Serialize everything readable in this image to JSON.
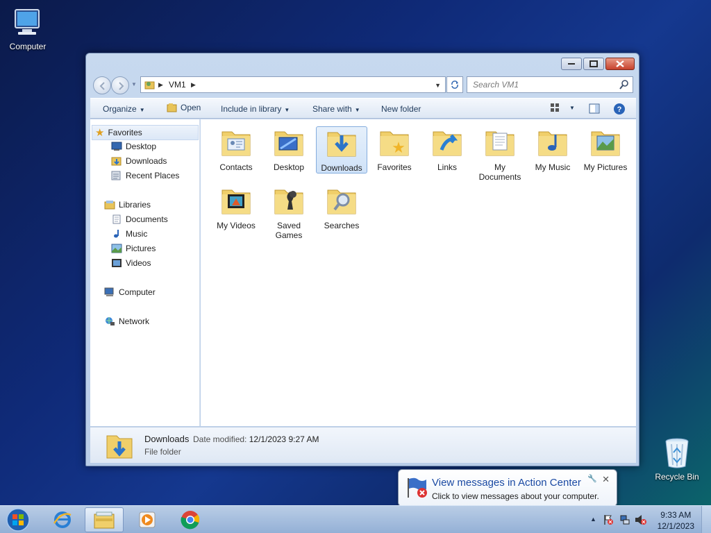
{
  "desktop": {
    "computer_label": "Computer",
    "recycle_label": "Recycle Bin"
  },
  "window": {
    "breadcrumb": "VM1",
    "search_placeholder": "Search VM1"
  },
  "toolbar": {
    "organize": "Organize",
    "open": "Open",
    "include": "Include in library",
    "share": "Share with",
    "new_folder": "New folder"
  },
  "nav": {
    "favorites": "Favorites",
    "desktop": "Desktop",
    "downloads": "Downloads",
    "recent": "Recent Places",
    "libraries": "Libraries",
    "documents": "Documents",
    "music": "Music",
    "pictures": "Pictures",
    "videos": "Videos",
    "computer": "Computer",
    "network": "Network"
  },
  "folders": [
    {
      "line1": "Contacts",
      "line2": "",
      "overlay": "contacts"
    },
    {
      "line1": "Desktop",
      "line2": "",
      "overlay": "desktop"
    },
    {
      "line1": "Downloads",
      "line2": "",
      "overlay": "downloads"
    },
    {
      "line1": "Favorites",
      "line2": "",
      "overlay": "favorites"
    },
    {
      "line1": "Links",
      "line2": "",
      "overlay": "links"
    },
    {
      "line1": "My",
      "line2": "Documents",
      "overlay": "documents"
    },
    {
      "line1": "My Music",
      "line2": "",
      "overlay": "music"
    },
    {
      "line1": "My Pictures",
      "line2": "",
      "overlay": "pictures"
    },
    {
      "line1": "My Videos",
      "line2": "",
      "overlay": "videos"
    },
    {
      "line1": "Saved",
      "line2": "Games",
      "overlay": "games"
    },
    {
      "line1": "Searches",
      "line2": "",
      "overlay": "searches"
    }
  ],
  "details": {
    "name": "Downloads",
    "modified_label": "Date modified:",
    "modified_value": "12/1/2023 9:27 AM",
    "type": "File folder"
  },
  "balloon": {
    "title": "View messages in Action Center",
    "message": "Click to view messages about your computer.",
    "close": "✕"
  },
  "clock": {
    "time": "9:33 AM",
    "date": "12/1/2023"
  }
}
